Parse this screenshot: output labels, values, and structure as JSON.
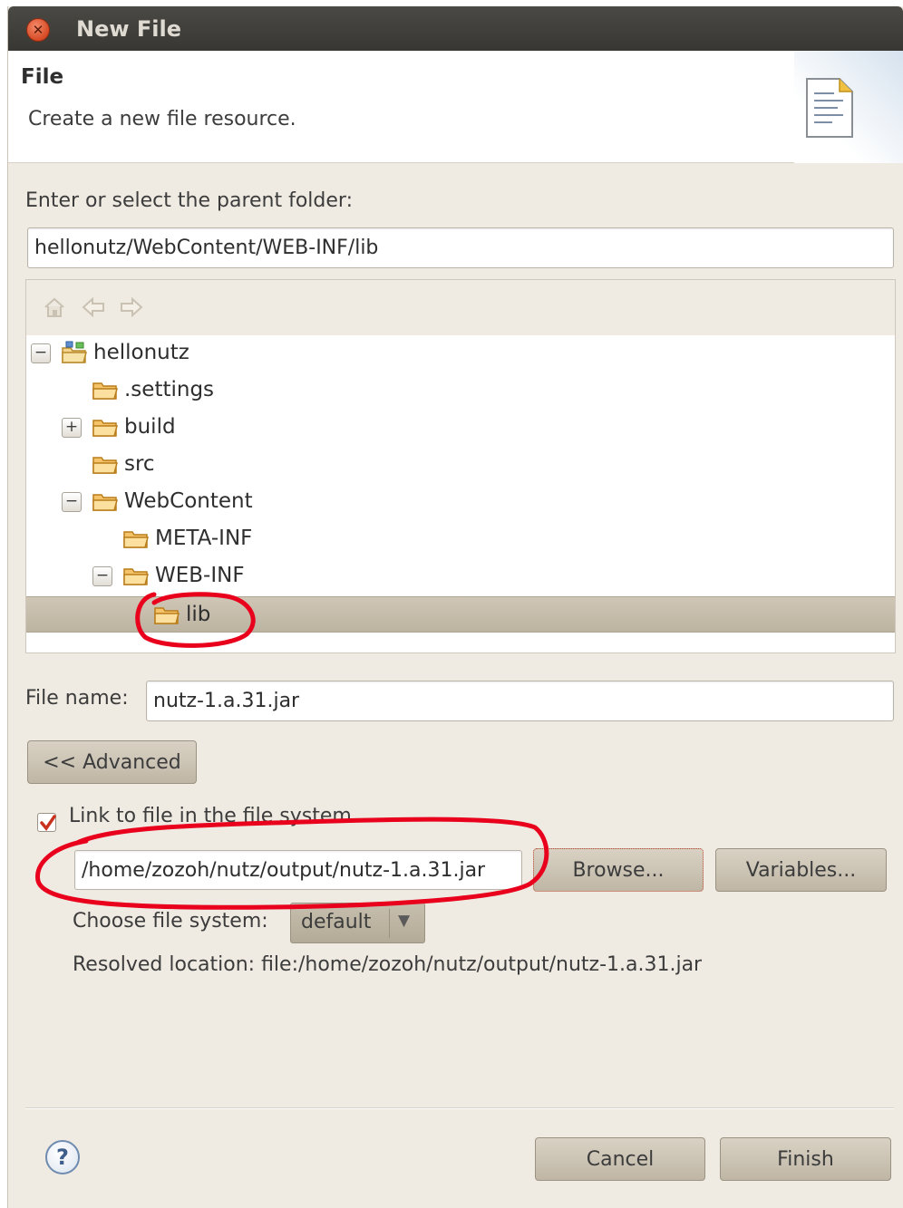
{
  "window": {
    "title": "New File"
  },
  "header": {
    "title": "File",
    "description": "Create a new file resource."
  },
  "parent_folder": {
    "label": "Enter or select the parent folder:",
    "value": "hellonutz/WebContent/WEB-INF/lib"
  },
  "tree": {
    "toolbar": [
      "home-icon",
      "back-arrow-icon",
      "forward-arrow-icon"
    ],
    "items": [
      {
        "label": "hellonutz",
        "expander": "−",
        "icon": "project-icon"
      },
      {
        "label": ".settings",
        "expander": "",
        "icon": "folder-icon"
      },
      {
        "label": "build",
        "expander": "+",
        "icon": "folder-icon"
      },
      {
        "label": "src",
        "expander": "",
        "icon": "folder-icon"
      },
      {
        "label": "WebContent",
        "expander": "−",
        "icon": "folder-icon"
      },
      {
        "label": "META-INF",
        "expander": "",
        "icon": "folder-icon"
      },
      {
        "label": "WEB-INF",
        "expander": "−",
        "icon": "folder-icon"
      },
      {
        "label": "lib",
        "expander": "",
        "icon": "folder-icon",
        "selected": true
      }
    ]
  },
  "file_name": {
    "label": "File name:",
    "value": "nutz-1.a.31.jar"
  },
  "advanced": {
    "button_label": "<< Advanced",
    "link_checkbox_label": "Link to file in the file system",
    "link_checked": true,
    "link_path": "/home/zozoh/nutz/output/nutz-1.a.31.jar",
    "browse_label": "Browse...",
    "variables_label": "Variables...",
    "file_system_label": "Choose file system:",
    "file_system_value": "default",
    "resolved_location": "Resolved location: file:/home/zozoh/nutz/output/nutz-1.a.31.jar"
  },
  "footer": {
    "cancel_label": "Cancel",
    "finish_label": "Finish",
    "help_symbol": "?"
  },
  "colors": {
    "annotation": "#e8001c",
    "checkbox_mark": "#c8321e",
    "folder": "#e8a23a"
  }
}
